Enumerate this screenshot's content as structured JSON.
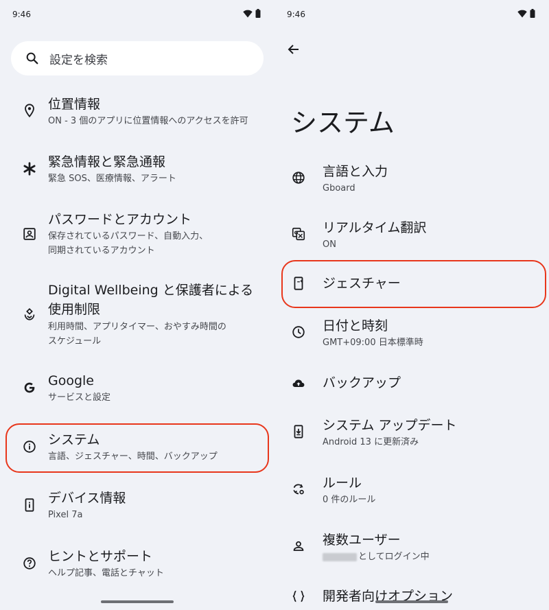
{
  "status": {
    "time": "9:46"
  },
  "left": {
    "search_placeholder": "設定を検索",
    "items": [
      {
        "title": "位置情報",
        "sub": "ON - 3 個のアプリに位置情報へのアクセスを許可",
        "icon": "location-pin-icon"
      },
      {
        "title": "緊急情報と緊急通報",
        "sub": "緊急 SOS、医療情報、アラート",
        "icon": "asterisk-icon"
      },
      {
        "title": "パスワードとアカウント",
        "sub_line1": "保存されているパスワード、自動入力、",
        "sub_line2": "同期されているアカウント",
        "icon": "account-box-icon"
      },
      {
        "title_line1": "Digital Wellbeing と保護者による",
        "title_line2": "使用制限",
        "sub_line1": "利用時間、アプリタイマー、おやすみ時間の",
        "sub_line2": "スケジュール",
        "icon": "wellbeing-icon"
      },
      {
        "title": "Google",
        "sub": "サービスと設定",
        "icon": "google-g-icon"
      },
      {
        "title": "システム",
        "sub": "言語、ジェスチャー、時間、バックアップ",
        "icon": "info-icon"
      },
      {
        "title": "デバイス情報",
        "sub": "Pixel 7a",
        "icon": "phone-info-icon"
      },
      {
        "title": "ヒントとサポート",
        "sub": "ヘルプ記事、電話とチャット",
        "icon": "help-icon"
      }
    ]
  },
  "right": {
    "page_title": "システム",
    "items": [
      {
        "title": "言語と入力",
        "sub": "Gboard",
        "icon": "globe-icon"
      },
      {
        "title": "リアルタイム翻訳",
        "sub": "ON",
        "icon": "translate-icon"
      },
      {
        "title": "ジェスチャー",
        "icon": "gesture-phone-icon"
      },
      {
        "title": "日付と時刻",
        "sub": "GMT+09:00 日本標準時",
        "icon": "clock-icon"
      },
      {
        "title": "バックアップ",
        "icon": "cloud-upload-icon"
      },
      {
        "title": "システム アップデート",
        "sub": "Android 13 に更新済み",
        "icon": "system-update-icon"
      },
      {
        "title": "ルール",
        "sub": "0 件のルール",
        "icon": "rules-icon"
      },
      {
        "title": "複数ユーザー",
        "sub": "としてログイン中",
        "icon": "person-icon"
      },
      {
        "title": "開発者向けオプション",
        "icon": "braces-icon"
      }
    ]
  },
  "colors": {
    "highlight": "#e8361b",
    "background": "#f0f2f7",
    "search_bg": "#ffffff"
  }
}
